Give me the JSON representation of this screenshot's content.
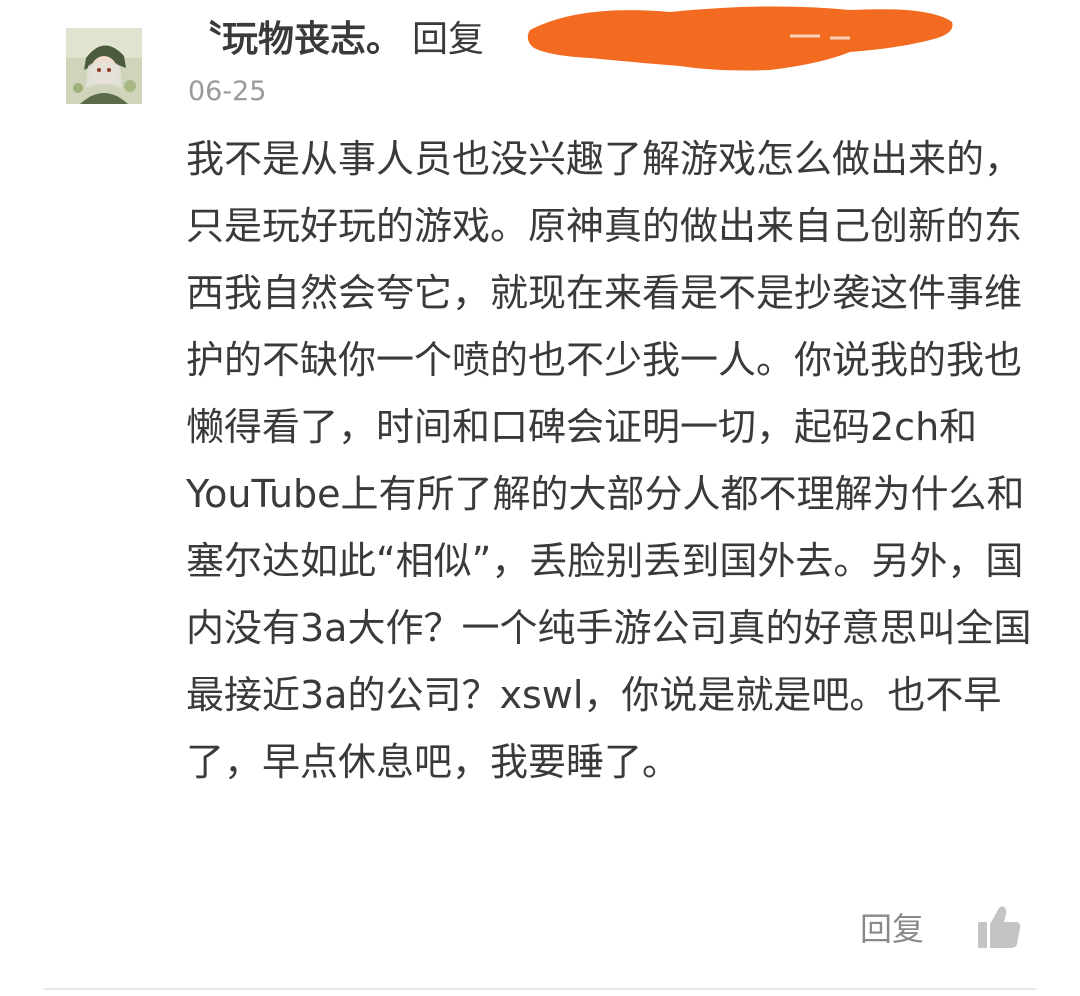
{
  "comment": {
    "username": "〝玩物丧志。",
    "reply_prefix": "回复",
    "date": "06-25",
    "body": "我不是从事人员也没兴趣了解游戏怎么做出来的，只是玩好玩的游戏。原神真的做出来自己创新的东西我自然会夸它，就现在来看是不是抄袭这件事维护的不缺你一个喷的也不少我一人。你说我的我也懒得看了，时间和口碑会证明一切，起码2ch和YouTube上有所了解的大部分人都不理解为什么和塞尔达如此“相似”，丢脸别丢到国外去。另外，国内没有3a大作？一个纯手游公司真的好意思叫全国最接近3a的公司？xswl，你说是就是吧。也不早了，早点休息吧，我要睡了。",
    "actions": {
      "reply_label": "回复",
      "like_icon": "thumbs-up-icon"
    },
    "colors": {
      "redaction": "#f36a21",
      "text": "#3a3a3a",
      "meta": "#9a9a9a",
      "icon": "#c4c4c4"
    }
  }
}
